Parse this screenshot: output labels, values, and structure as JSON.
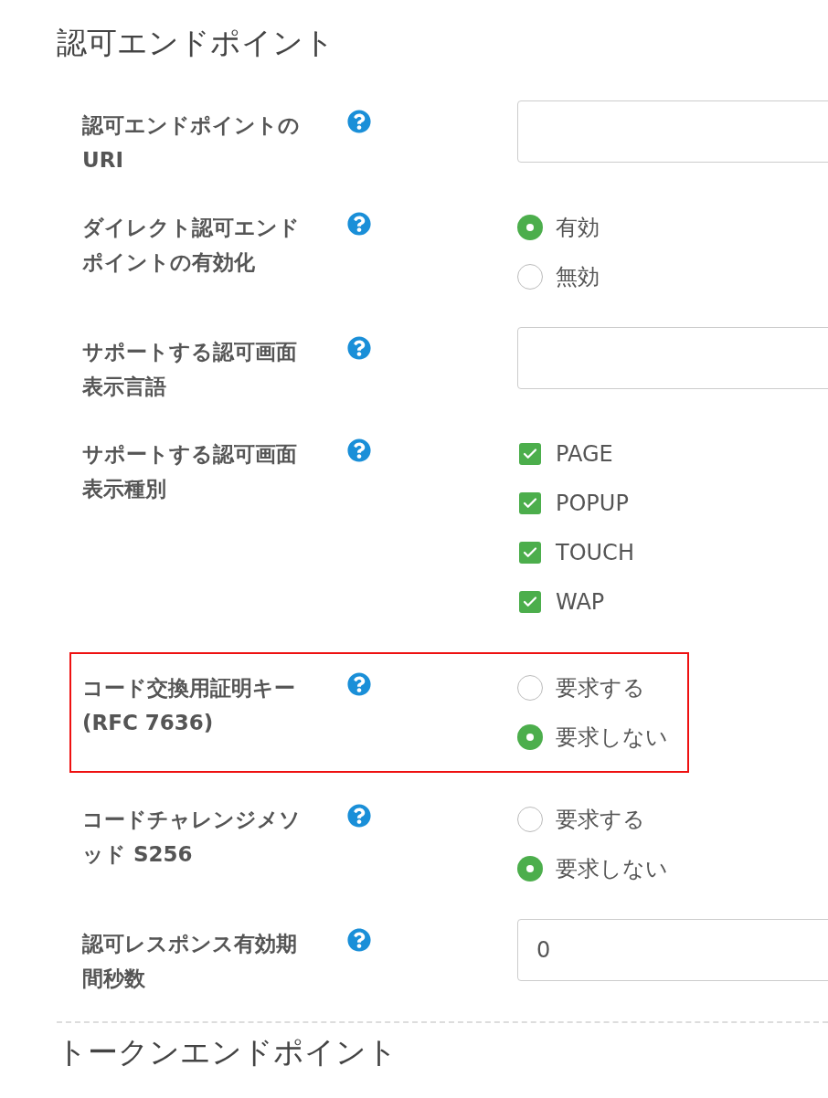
{
  "section_title": "認可エンドポイント",
  "fields": [
    {
      "kind": "text",
      "label": "認可エンドポイントの URI",
      "highlighted": false
    },
    {
      "kind": "radio",
      "label": "ダイレクト認可エンドポイントの有効化",
      "highlighted": false,
      "options": [
        {
          "label": "有効",
          "selected": true
        },
        {
          "label": "無効",
          "selected": false
        }
      ]
    },
    {
      "kind": "text",
      "label": "サポートする認可画面表示言語",
      "highlighted": false
    },
    {
      "kind": "checkbox",
      "label": "サポートする認可画面表示種別",
      "highlighted": false,
      "options": [
        {
          "label": "PAGE",
          "checked": true
        },
        {
          "label": "POPUP",
          "checked": true
        },
        {
          "label": "TOUCH",
          "checked": true
        },
        {
          "label": "WAP",
          "checked": true
        }
      ]
    },
    {
      "kind": "radio",
      "label": "コード交換用証明キー (RFC 7636)",
      "highlighted": true,
      "options": [
        {
          "label": "要求する",
          "selected": false
        },
        {
          "label": "要求しない",
          "selected": true
        }
      ]
    },
    {
      "kind": "radio",
      "label": "コードチャレンジメソッド S256",
      "highlighted": false,
      "options": [
        {
          "label": "要求する",
          "selected": false
        },
        {
          "label": "要求しない",
          "selected": true
        }
      ]
    },
    {
      "kind": "text",
      "label": "認可レスポンス有効期間秒数",
      "highlighted": false,
      "value": "0"
    }
  ],
  "next_section_title": "トークンエンドポイント"
}
